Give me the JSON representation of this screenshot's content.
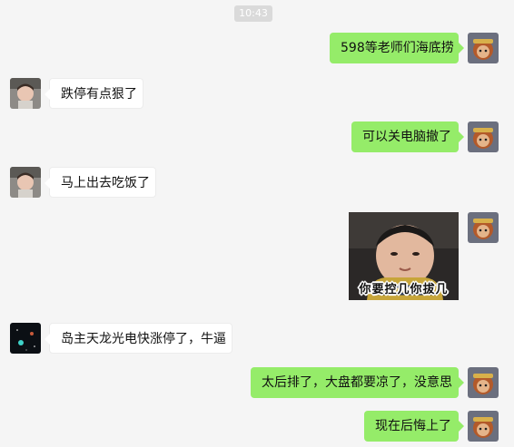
{
  "timestamp": "10:43",
  "messages": [
    {
      "side": "right",
      "text": "598等老师们海底捞"
    },
    {
      "side": "left",
      "text": "跌停有点狠了"
    },
    {
      "side": "right",
      "text": "可以关电脑撤了"
    },
    {
      "side": "left",
      "text": "马上出去吃饭了"
    },
    {
      "side": "right",
      "type": "sticker",
      "caption": "你要控几你拔几"
    },
    {
      "side": "left",
      "text": "岛主天龙光电快涨停了，牛逼"
    },
    {
      "side": "right",
      "text": "太后排了，大盘都要凉了，没意思"
    },
    {
      "side": "right",
      "text": "现在后悔上了"
    }
  ],
  "colors": {
    "background": "#f5f5f5",
    "bubble_right": "#95ec69",
    "bubble_left": "#ffffff",
    "timestamp_bg": "#dadada"
  }
}
